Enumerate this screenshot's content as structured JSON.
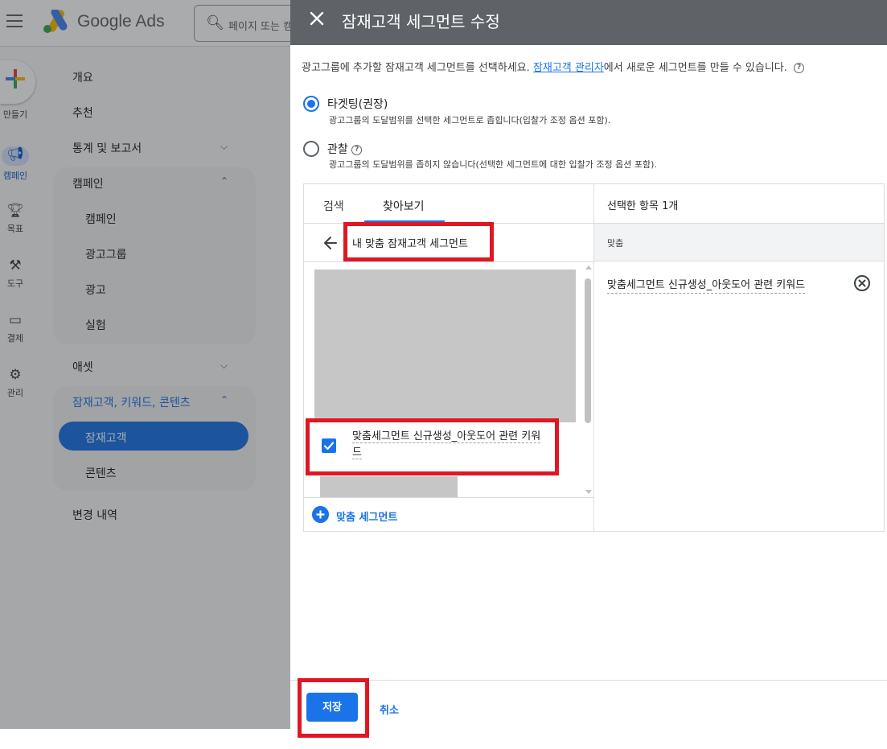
{
  "app": {
    "logo_text": "Google Ads",
    "search_placeholder": "페이지 또는 캠",
    "create_label": "만들기"
  },
  "rail": [
    {
      "icon": "campaign-icon",
      "label": "캠페인",
      "active": true
    },
    {
      "icon": "trophy-icon",
      "label": "목표"
    },
    {
      "icon": "tools-icon",
      "label": "도구"
    },
    {
      "icon": "billing-icon",
      "label": "결제"
    },
    {
      "icon": "gear-icon",
      "label": "관리"
    }
  ],
  "nav": {
    "overview": "개요",
    "recommendations": "추천",
    "stats_reports": "통계 및 보고서",
    "campaigns_group": "캠페인",
    "campaigns": "캠페인",
    "ad_groups": "광고그룹",
    "ads": "광고",
    "experiments": "실험",
    "assets": "애셋",
    "audience_group": "잠재고객, 키워드, 콘텐츠",
    "audiences": "잠재고객",
    "content": "콘텐츠",
    "change_history": "변경 내역"
  },
  "dialog": {
    "title": "잠재고객 세그먼트 수정",
    "intro_before": "광고그룹에 추가할 잠재고객 세그먼트를 선택하세요. ",
    "intro_link": "잠재고객 관리자",
    "intro_after": "에서 새로운 세그먼트를 만들 수 있습니다.",
    "targeting_label": "타겟팅(권장)",
    "targeting_desc": "광고그룹의 도달범위를 선택한 세그먼트로 좁힙니다(입찰가 조정 옵션 포함).",
    "observation_label": "관찰",
    "observation_desc": "광고그룹의 도달범위를 좁히지 않습니다(선택한 세그먼트에 대한 입찰가 조정 옵션 포함).",
    "tab_search": "검색",
    "tab_browse": "찾아보기",
    "folder_title": "내 맞춤 잠재고객 세그먼트",
    "item_label": "맞춤세그먼트 신규생성_아웃도어 관련 키워드",
    "add_segment": "맞춤 세그먼트",
    "selected_header": "선택한 항목 1개",
    "selected_group": "맞춤",
    "selected_item": "맞춤세그먼트 신규생성_아웃도어 관련 키워드",
    "save": "저장",
    "cancel": "취소"
  },
  "colors": {
    "accent": "#1a73e8",
    "header": "#5f6368",
    "highlight_box": "#e01722",
    "placeholder_gray": "#c6c6c6"
  }
}
